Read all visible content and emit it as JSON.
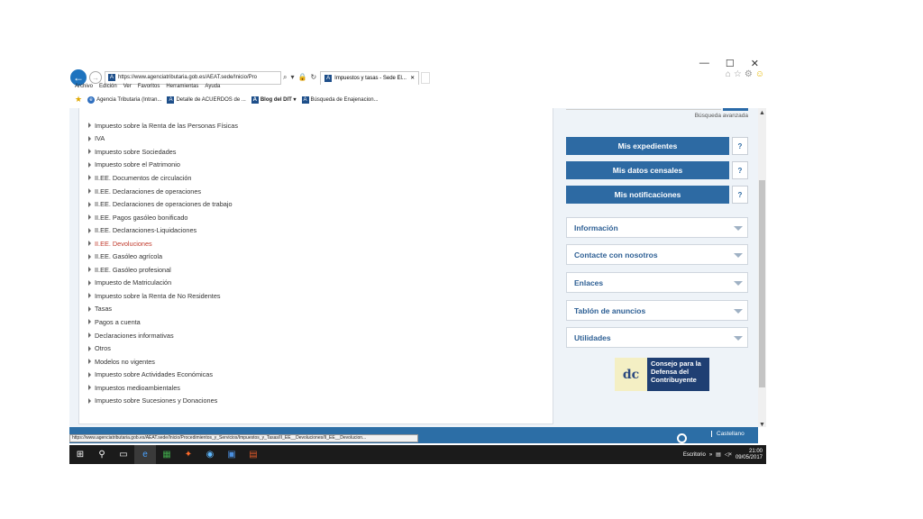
{
  "window": {
    "controls": [
      "—",
      "☐",
      "✕"
    ]
  },
  "browser": {
    "url": "https://www.agenciatributaria.gob.es/AEAT.sede/Inicio/Pro",
    "tab_title": "Impuestos y tasas - Sede El...",
    "menu": [
      "Archivo",
      "Edición",
      "Ver",
      "Favoritos",
      "Herramientas",
      "Ayuda"
    ],
    "favorites": [
      {
        "label": "Agencia Tributaria (Intran...",
        "bold": false
      },
      {
        "label": "Detalle de ACUERDOS de ...",
        "bold": false
      },
      {
        "label": "Blog del DIT ▾",
        "bold": true
      },
      {
        "label": "Búsqueda de Enajenacion...",
        "bold": false
      }
    ],
    "status_url": "https://www.agenciatributaria.gob.es/AEAT.sede/Inicio/Procedimientos_y_Servicios/Impuestos_y_Tasas/II_EE__Devoluciones/II_EE__Devolucion..."
  },
  "left_list": {
    "items": [
      {
        "label": "Impuesto sobre la Renta de las Personas Físicas",
        "active": false
      },
      {
        "label": "IVA",
        "active": false
      },
      {
        "label": "Impuesto sobre Sociedades",
        "active": false
      },
      {
        "label": "Impuesto sobre el Patrimonio",
        "active": false
      },
      {
        "label": "II.EE. Documentos de circulación",
        "active": false
      },
      {
        "label": "II.EE. Declaraciones de operaciones",
        "active": false
      },
      {
        "label": "II.EE. Declaraciones de operaciones de trabajo",
        "active": false
      },
      {
        "label": "II.EE. Pagos gasóleo bonificado",
        "active": false
      },
      {
        "label": "II.EE. Declaraciones-Liquidaciones",
        "active": false
      },
      {
        "label": "II.EE. Devoluciones",
        "active": true
      },
      {
        "label": "II.EE. Gasóleo agrícola",
        "active": false
      },
      {
        "label": "II.EE. Gasóleo profesional",
        "active": false
      },
      {
        "label": "Impuesto de Matriculación",
        "active": false
      },
      {
        "label": "Impuesto sobre la Renta de No Residentes",
        "active": false
      },
      {
        "label": "Tasas",
        "active": false
      },
      {
        "label": "Pagos a cuenta",
        "active": false
      },
      {
        "label": "Declaraciones informativas",
        "active": false
      },
      {
        "label": "Otros",
        "active": false
      },
      {
        "label": "Modelos no vigentes",
        "active": false
      },
      {
        "label": "Impuesto sobre Actividades Económicas",
        "active": false
      },
      {
        "label": "Impuestos medioambientales",
        "active": false
      },
      {
        "label": "Impuesto sobre Sucesiones y Donaciones",
        "active": false
      }
    ]
  },
  "right_panel": {
    "advanced_search": "Búsqueda avanzada",
    "buttons": [
      {
        "label": "Mis expedientes",
        "help": "?"
      },
      {
        "label": "Mis datos censales",
        "help": "?"
      },
      {
        "label": "Mis notificaciones",
        "help": "?"
      }
    ],
    "accordions": [
      "Información",
      "Contacte con nosotros",
      "Enlaces",
      "Tablón de anuncios",
      "Utilidades"
    ],
    "logo_text": "Consejo para la Defensa del Contribuyente"
  },
  "footer": {
    "language": "Castellano"
  },
  "taskbar": {
    "desktop_label": "Escritorio",
    "time": "21:00",
    "date": "09/05/2017"
  },
  "colors": {
    "accent": "#2d6aa3",
    "active_link": "#c0392b"
  }
}
